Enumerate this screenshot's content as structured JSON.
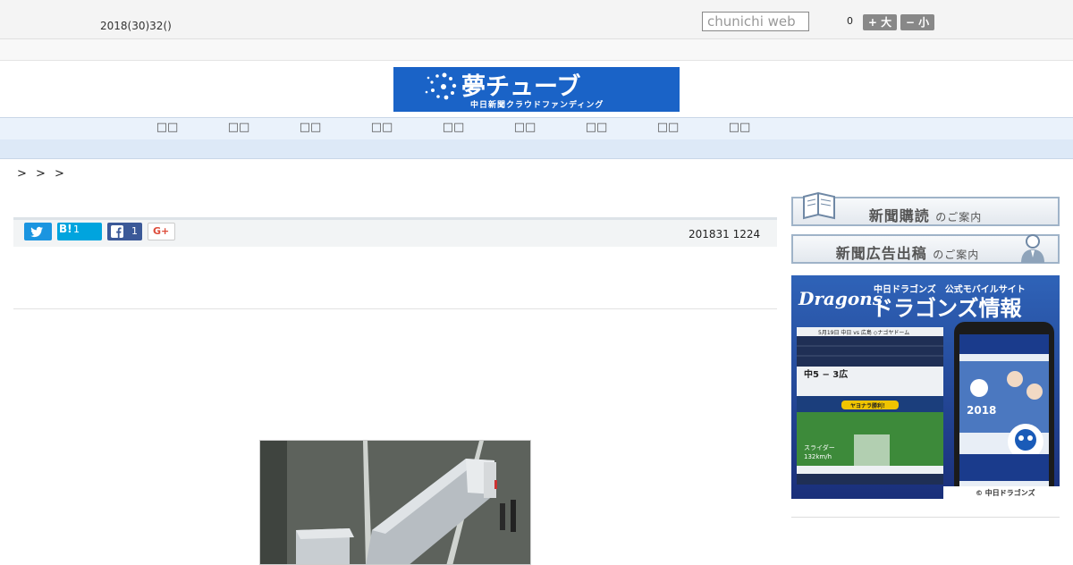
{
  "header": {
    "date": "2018(30)32()",
    "search_placeholder": "chunichi web",
    "font_size_value": "0",
    "font_larger_label": "+ 大",
    "font_smaller_label": "− 小"
  },
  "banner": {
    "title": "夢チューブ",
    "subtitle": "中日新聞クラウドファンディング",
    "bg_color": "#1a63c7"
  },
  "nav": {
    "items": [
      "□□",
      "□□",
      "□□",
      "□□",
      "□□",
      "□□",
      "□□",
      "□□",
      "□□"
    ]
  },
  "breadcrumb": ">  >  >",
  "article": {
    "share": {
      "twitter_icon": "twitter-icon",
      "hatena_label": "B!",
      "hatena_count": "1",
      "facebook_icon": "facebook-icon",
      "facebook_count": "1",
      "gplus_label": "G+"
    },
    "published": "201831 1224"
  },
  "sidebar": {
    "subscribe_main": "新聞購読",
    "subscribe_sub": "のご案内",
    "ads_main": "新聞広告出稿",
    "ads_sub": "のご案内",
    "ad": {
      "brand": "Dragons",
      "header_small": "中日ドラゴンズ　公式モバイルサイト",
      "header_big": "ドラゴンズ情報",
      "game_line": "5月19日 中日 vs 広島 ◇ナゴヤドーム",
      "score_line": "中5 − 3広",
      "highlight": "ヤヨナラ勝利！",
      "pitch_label": "スライダー",
      "pitch_speed": "132km/h",
      "phone_year": "2018",
      "footer": "© 中日ドラゴンズ"
    }
  }
}
